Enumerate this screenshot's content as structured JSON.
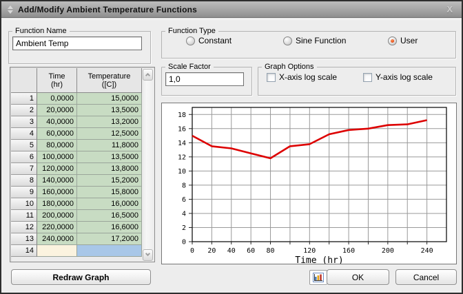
{
  "window": {
    "title": "Add/Modify Ambient Temperature Functions",
    "close_icon": "X"
  },
  "function_name": {
    "group_label": "Function Name",
    "value": "Ambient Temp"
  },
  "function_type": {
    "group_label": "Function Type",
    "options": [
      {
        "label": "Constant",
        "selected": false
      },
      {
        "label": "Sine Function",
        "selected": false
      },
      {
        "label": "User",
        "selected": true
      }
    ]
  },
  "scale_factor": {
    "group_label": "Scale Factor",
    "value": "1,0"
  },
  "graph_options": {
    "group_label": "Graph Options",
    "checkboxes": [
      {
        "label": "X-axis log scale",
        "checked": false
      },
      {
        "label": "Y-axis log scale",
        "checked": false
      }
    ]
  },
  "table": {
    "columns": {
      "num": "",
      "time": [
        "Time",
        "(hr)"
      ],
      "temp": [
        "Temperature",
        "([C])"
      ]
    },
    "rows": [
      {
        "num": "1",
        "time": "0,0000",
        "temp": "15,0000"
      },
      {
        "num": "2",
        "time": "20,0000",
        "temp": "13,5000"
      },
      {
        "num": "3",
        "time": "40,0000",
        "temp": "13,2000"
      },
      {
        "num": "4",
        "time": "60,0000",
        "temp": "12,5000"
      },
      {
        "num": "5",
        "time": "80,0000",
        "temp": "11,8000"
      },
      {
        "num": "6",
        "time": "100,0000",
        "temp": "13,5000"
      },
      {
        "num": "7",
        "time": "120,0000",
        "temp": "13,8000"
      },
      {
        "num": "8",
        "time": "140,0000",
        "temp": "15,2000"
      },
      {
        "num": "9",
        "time": "160,0000",
        "temp": "15,8000"
      },
      {
        "num": "10",
        "time": "180,0000",
        "temp": "16,0000"
      },
      {
        "num": "11",
        "time": "200,0000",
        "temp": "16,5000"
      },
      {
        "num": "12",
        "time": "220,0000",
        "temp": "16,6000"
      },
      {
        "num": "13",
        "time": "240,0000",
        "temp": "17,2000"
      },
      {
        "num": "14",
        "time": "",
        "temp": "",
        "empty": true
      }
    ]
  },
  "buttons": {
    "redraw": "Redraw Graph",
    "ok": "OK",
    "cancel": "Cancel"
  },
  "colors": {
    "line_red": "#dd0000",
    "grid_gray": "#999999",
    "cell_green": "#c8dcc3",
    "cell_cream": "#fbf3df",
    "cell_selected_blue": "#a8c7e8",
    "radio_selected": "#e2440f"
  },
  "chart_data": {
    "type": "line",
    "title": "",
    "xlabel": "Time (hr)",
    "ylabel": "",
    "x": [
      0,
      20,
      40,
      60,
      80,
      100,
      120,
      140,
      160,
      180,
      200,
      220,
      240
    ],
    "y": [
      15.0,
      13.5,
      13.2,
      12.5,
      11.8,
      13.5,
      13.8,
      15.2,
      15.8,
      16.0,
      16.5,
      16.6,
      17.2
    ],
    "xlim": [
      0,
      260
    ],
    "ylim": [
      0,
      19
    ],
    "x_gridline_step": 20,
    "y_gridline_step": 2,
    "x_ticks_labeled": [
      0,
      20,
      40,
      60,
      80,
      120,
      160,
      200,
      240
    ],
    "y_ticks_labeled": [
      0,
      2,
      4,
      6,
      8,
      10,
      12,
      14,
      16,
      18
    ],
    "grid": true,
    "legend": null,
    "line_color": "#dd0000"
  }
}
